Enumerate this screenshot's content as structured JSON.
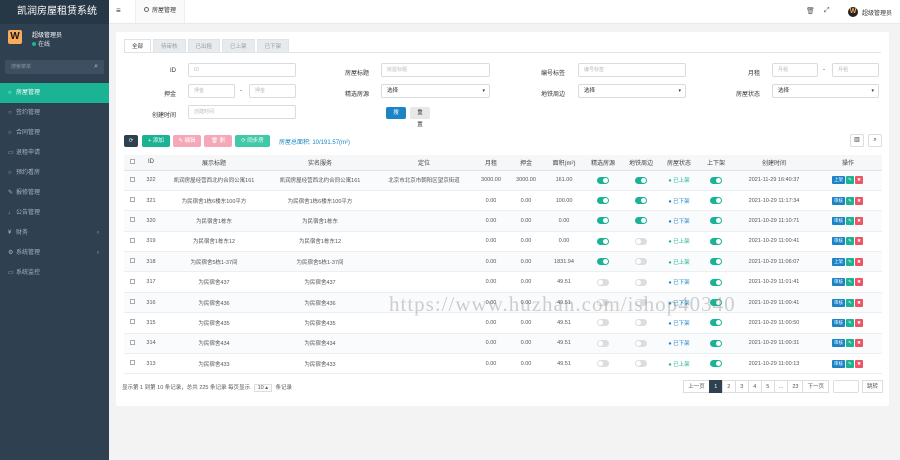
{
  "app": {
    "title": "凯润房屋租赁系统"
  },
  "sidebar": {
    "user": {
      "name": "超级管理员",
      "status": "在线",
      "logo": "W"
    },
    "search_placeholder": "搜索菜单",
    "items": [
      {
        "label": "房屋管理",
        "icon": "home-icon",
        "glyph": "○",
        "active": true,
        "arrow": ""
      },
      {
        "label": "签约管理",
        "icon": "circle-icon",
        "glyph": "○",
        "active": false,
        "arrow": ""
      },
      {
        "label": "合同管理",
        "icon": "circle-icon",
        "glyph": "○",
        "active": false,
        "arrow": ""
      },
      {
        "label": "退租申请",
        "icon": "card-icon",
        "glyph": "▭",
        "active": false,
        "arrow": ""
      },
      {
        "label": "预约看房",
        "icon": "circle-icon",
        "glyph": "○",
        "active": false,
        "arrow": ""
      },
      {
        "label": "报修管理",
        "icon": "wrench-icon",
        "glyph": "✎",
        "active": false,
        "arrow": ""
      },
      {
        "label": "公告管理",
        "icon": "bell-icon",
        "glyph": "♩",
        "active": false,
        "arrow": ""
      },
      {
        "label": "财务",
        "icon": "yen-icon",
        "glyph": "¥",
        "active": false,
        "arrow": "‹"
      },
      {
        "label": "系统管理",
        "icon": "gear-icon",
        "glyph": "⚙",
        "active": false,
        "arrow": "‹"
      },
      {
        "label": "系统监控",
        "icon": "monitor-icon",
        "glyph": "▭",
        "active": false,
        "arrow": ""
      }
    ]
  },
  "topbar": {
    "tab_label": "房屋管理",
    "admin_label": "超级管理员",
    "admin_logo": "W",
    "trash_glyph": "🗑",
    "expand_glyph": "⤢",
    "menu_glyph": "≡"
  },
  "status_tabs": [
    "全部",
    "待审核",
    "已出租",
    "已上架",
    "已下架"
  ],
  "filters": {
    "id": {
      "label": "ID",
      "placeholder": "ID"
    },
    "title": {
      "label": "房屋标题",
      "placeholder": "房屋标题"
    },
    "code": {
      "label": "编号标签",
      "placeholder": "编号标签"
    },
    "rent": {
      "label": "月租",
      "from": "月租",
      "to": "月租",
      "sep": "-"
    },
    "deposit": {
      "label": "押金",
      "from": "押金",
      "to": "押金",
      "sep": "-"
    },
    "hot": {
      "label": "精选房源",
      "value": "选择"
    },
    "ad": {
      "label": "地铁周边",
      "value": "选择"
    },
    "state": {
      "label": "房屋状态",
      "value": "选择"
    },
    "created": {
      "label": "创建时间",
      "placeholder": "创建时间"
    }
  },
  "buttons": {
    "search": "搜索",
    "reset": "重置",
    "add": "+ 添加",
    "edit": "✎ 编辑",
    "delete": "🗑 删除",
    "sync": "⟳ 同步房",
    "area_label": "房屋总面积: 10/191.57(m²)"
  },
  "table": {
    "headers": [
      "",
      "ID",
      "展示标题",
      "实名服务",
      "定位",
      "月租",
      "押金",
      "面积(m²)",
      "精选房源",
      "地铁周边",
      "房屋状态",
      "上下架",
      "创建时间",
      "操作"
    ],
    "rows": [
      {
        "id": "322",
        "title": "凯润房屋经营西北约合同公寓161",
        "name": "凯润房屋经营西北约合同公寓161",
        "loc": "北京市北京市朝阳区望京街道",
        "rent": "3000.00",
        "deposit": "3000.00",
        "area": "161.00",
        "hot": true,
        "metro": true,
        "state": "已上架",
        "state_cls": "up",
        "shelf": true,
        "created": "2021-11-29 16:40:37",
        "act": "上架"
      },
      {
        "id": "321",
        "title": "为民宿舍1栋6楼东100平方",
        "name": "为民宿舍1栋6楼东100平方",
        "loc": "",
        "rent": "0.00",
        "deposit": "0.00",
        "area": "100.00",
        "hot": true,
        "metro": true,
        "state": "已下架",
        "state_cls": "down",
        "shelf": true,
        "created": "2021-10-29 11:17:34",
        "act": "审核"
      },
      {
        "id": "320",
        "title": "为民宿舍1栋东",
        "name": "为民宿舍1栋东",
        "loc": "",
        "rent": "0.00",
        "deposit": "0.00",
        "area": "0.00",
        "hot": true,
        "metro": true,
        "state": "已下架",
        "state_cls": "down",
        "shelf": true,
        "created": "2021-10-29 11:10:71",
        "act": "审核"
      },
      {
        "id": "319",
        "title": "为民宿舍1栋东12",
        "name": "为民宿舍1栋东12",
        "loc": "",
        "rent": "0.00",
        "deposit": "0.00",
        "area": "0.00",
        "hot": true,
        "metro": false,
        "state": "已上架",
        "state_cls": "up",
        "shelf": true,
        "created": "2021-10-29 11:00:41",
        "act": "审核"
      },
      {
        "id": "318",
        "title": "为民宿舍5栋1-37间",
        "name": "为民宿舍5栋1-37间",
        "loc": "",
        "rent": "0.00",
        "deposit": "0.00",
        "area": "1831.94",
        "hot": true,
        "metro": false,
        "state": "已上架",
        "state_cls": "up",
        "shelf": true,
        "created": "2021-10-29 11:06:07",
        "act": "上架"
      },
      {
        "id": "317",
        "title": "为民宿舍437",
        "name": "为民宿舍437",
        "loc": "",
        "rent": "0.00",
        "deposit": "0.00",
        "area": "49.51",
        "hot": false,
        "metro": false,
        "state": "已下架",
        "state_cls": "down",
        "shelf": true,
        "created": "2021-10-29 11:01:41",
        "act": "审核"
      },
      {
        "id": "316",
        "title": "为民宿舍436",
        "name": "为民宿舍436",
        "loc": "",
        "rent": "0.00",
        "deposit": "0.00",
        "area": "49.51",
        "hot": false,
        "metro": false,
        "state": "已下架",
        "state_cls": "down",
        "shelf": true,
        "created": "2021-10-29 11:00:41",
        "act": "审核"
      },
      {
        "id": "315",
        "title": "为民宿舍435",
        "name": "为民宿舍435",
        "loc": "",
        "rent": "0.00",
        "deposit": "0.00",
        "area": "49.51",
        "hot": false,
        "metro": false,
        "state": "已下架",
        "state_cls": "down",
        "shelf": true,
        "created": "2021-10-29 11:00:50",
        "act": "审核"
      },
      {
        "id": "314",
        "title": "为民宿舍434",
        "name": "为民宿舍434",
        "loc": "",
        "rent": "0.00",
        "deposit": "0.00",
        "area": "49.51",
        "hot": false,
        "metro": false,
        "state": "已下架",
        "state_cls": "down",
        "shelf": true,
        "created": "2021-10-29 11:00:31",
        "act": "审核"
      },
      {
        "id": "313",
        "title": "为民宿舍433",
        "name": "为民宿舍433",
        "loc": "",
        "rent": "0.00",
        "deposit": "0.00",
        "area": "49.51",
        "hot": false,
        "metro": false,
        "state": "已上架",
        "state_cls": "up",
        "shelf": true,
        "created": "2021-10-29 11:00:13",
        "act": "审核"
      }
    ]
  },
  "footer": {
    "text_before": "显示第 1 到第 10 条记录，总共 225 条记录 每页显示",
    "page_size": "10 ▴",
    "text_after": "条记录"
  },
  "pager": {
    "prev": "上一页",
    "pages": [
      "1",
      "2",
      "3",
      "4",
      "5",
      "...",
      "23"
    ],
    "next": "下一页",
    "go": "跳转"
  },
  "watermark": "https://www.huzhan.com/ishop40340",
  "colors": {
    "accent": "#1ab394",
    "sidebar": "#2f4050",
    "primary": "#1c84c6",
    "danger": "#ed5565"
  }
}
